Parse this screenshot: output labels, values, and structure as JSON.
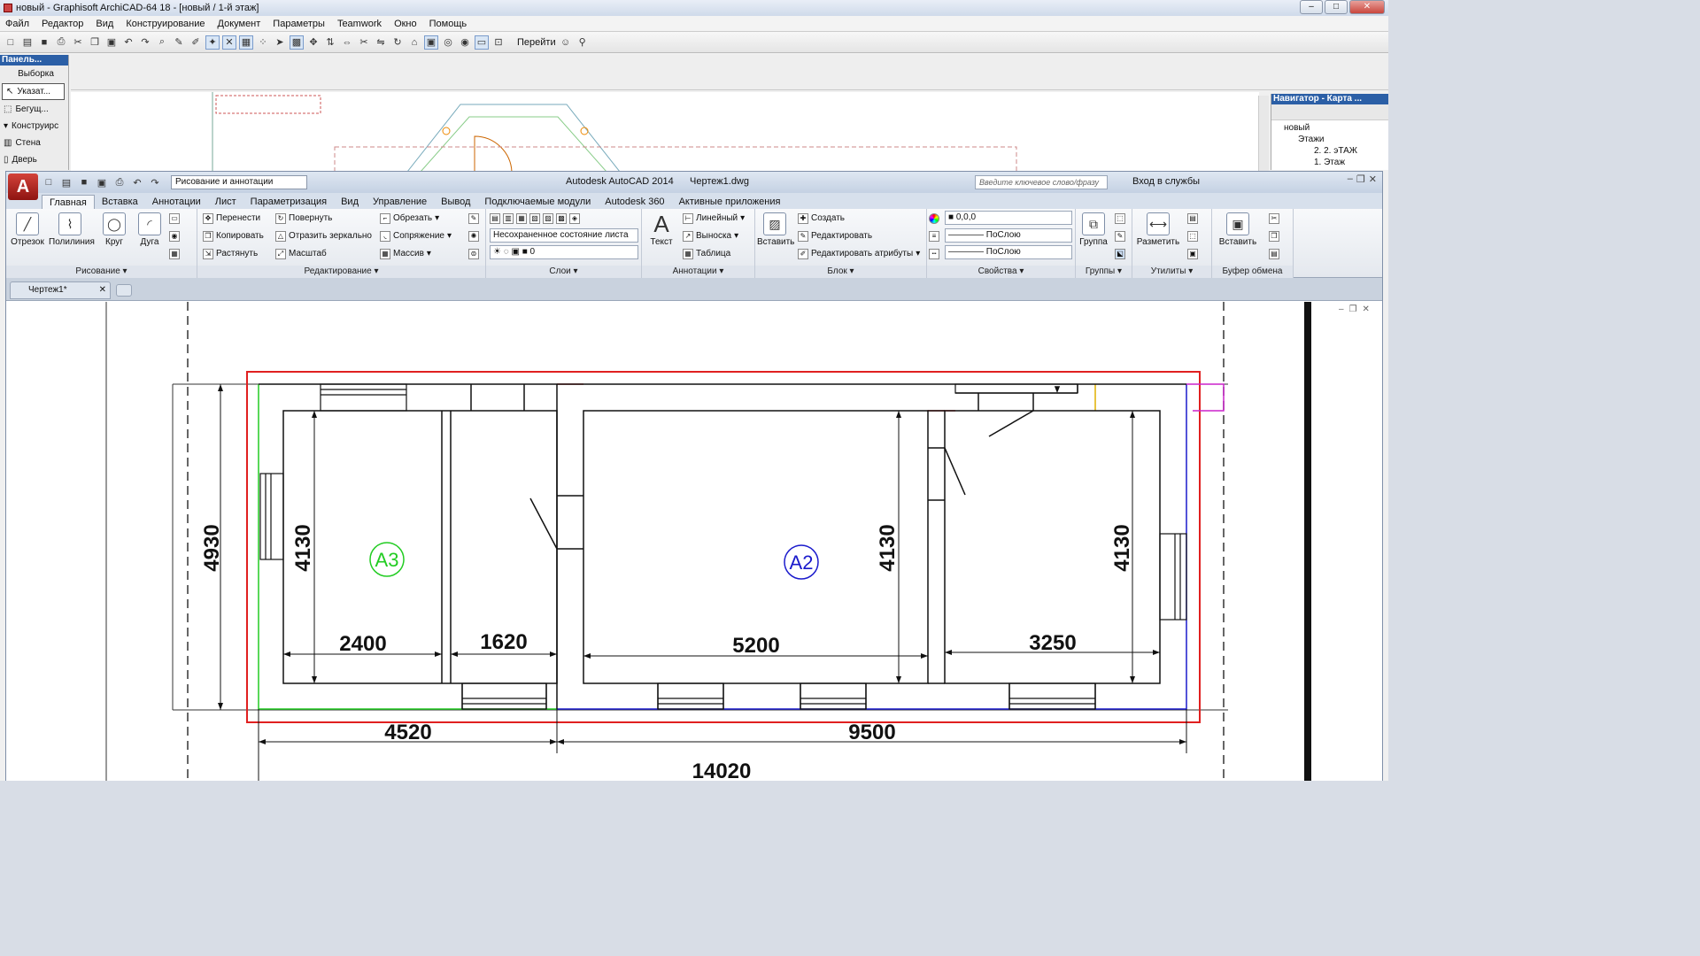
{
  "archicad": {
    "title": "новый - Graphisoft ArchiCAD-64 18 - [новый / 1-й этаж]",
    "menu": [
      "Файл",
      "Редактор",
      "Вид",
      "Конструирование",
      "Документ",
      "Параметры",
      "Teamwork",
      "Окно",
      "Помощь"
    ],
    "goto_label": "Перейти",
    "left_panel": {
      "title": "Панель...",
      "section": "Выборка",
      "items": [
        "Указат...",
        "Бегущ...",
        "Конструирс",
        "Стена",
        "Дверь"
      ]
    },
    "navigator": {
      "title": "Навигатор - Карта ...",
      "tree": [
        "новый",
        "Этажи",
        "2. 2. эТАЖ",
        "1. Этаж"
      ]
    }
  },
  "autocad": {
    "app_title": "Autodesk AutoCAD 2014",
    "file_title": "Чертеж1.dwg",
    "workspace": "Рисование и аннотации",
    "search_placeholder": "Введите ключевое слово/фразу",
    "login": "Вход в службы",
    "tabs": [
      "Главная",
      "Вставка",
      "Аннотации",
      "Лист",
      "Параметризация",
      "Вид",
      "Управление",
      "Вывод",
      "Подключаемые модули",
      "Autodesk 360",
      "Активные приложения"
    ],
    "active_tab": "Главная",
    "panels": {
      "draw": {
        "title": "Рисование",
        "buttons": [
          "Отрезок",
          "Полилиния",
          "Круг",
          "Дуга"
        ]
      },
      "modify": {
        "title": "Редактирование",
        "items": [
          "Перенести",
          "Повернуть",
          "Обрезать",
          "Копировать",
          "Отразить зеркально",
          "Сопряжение",
          "Растянуть",
          "Масштаб",
          "Массив"
        ]
      },
      "layers": {
        "title": "Слои",
        "state": "Несохраненное состояние листа",
        "current": "0"
      },
      "annotations": {
        "title": "Аннотации",
        "big": "Текст",
        "items": [
          "Линейный",
          "Выноска",
          "Таблица"
        ]
      },
      "block": {
        "title": "Блок",
        "big": "Вставить",
        "items": [
          "Создать",
          "Редактировать",
          "Редактировать атрибуты"
        ]
      },
      "properties": {
        "title": "Свойства",
        "color": "0,0,0",
        "linetype": "ПоСлою",
        "lineweight": "ПоСлою"
      },
      "groups": {
        "title": "Группы",
        "big": "Группа"
      },
      "utilities": {
        "title": "Утилиты",
        "big": "Разметить"
      },
      "clipboard": {
        "title": "Буфер обмена",
        "big": "Вставить"
      }
    },
    "doc_tab": "Чертеж1*"
  },
  "drawing": {
    "labels": {
      "room_a3": "А3",
      "room_a2": "А2",
      "dim_total_h": "4930",
      "dim_h1": "4130",
      "dim_h2": "4130",
      "dim_h3": "4130",
      "dim_w1": "2400",
      "dim_w2": "1620",
      "dim_w3": "5200",
      "dim_w4": "3250",
      "dim_s1": "4520",
      "dim_s2": "9500",
      "dim_total_w": "14020"
    },
    "colors": {
      "highlight": "#e02020",
      "a3": "#22cc22",
      "a2": "#1a1acc",
      "accent_magenta": "#cc22cc",
      "accent_yellow": "#e0b000"
    }
  }
}
